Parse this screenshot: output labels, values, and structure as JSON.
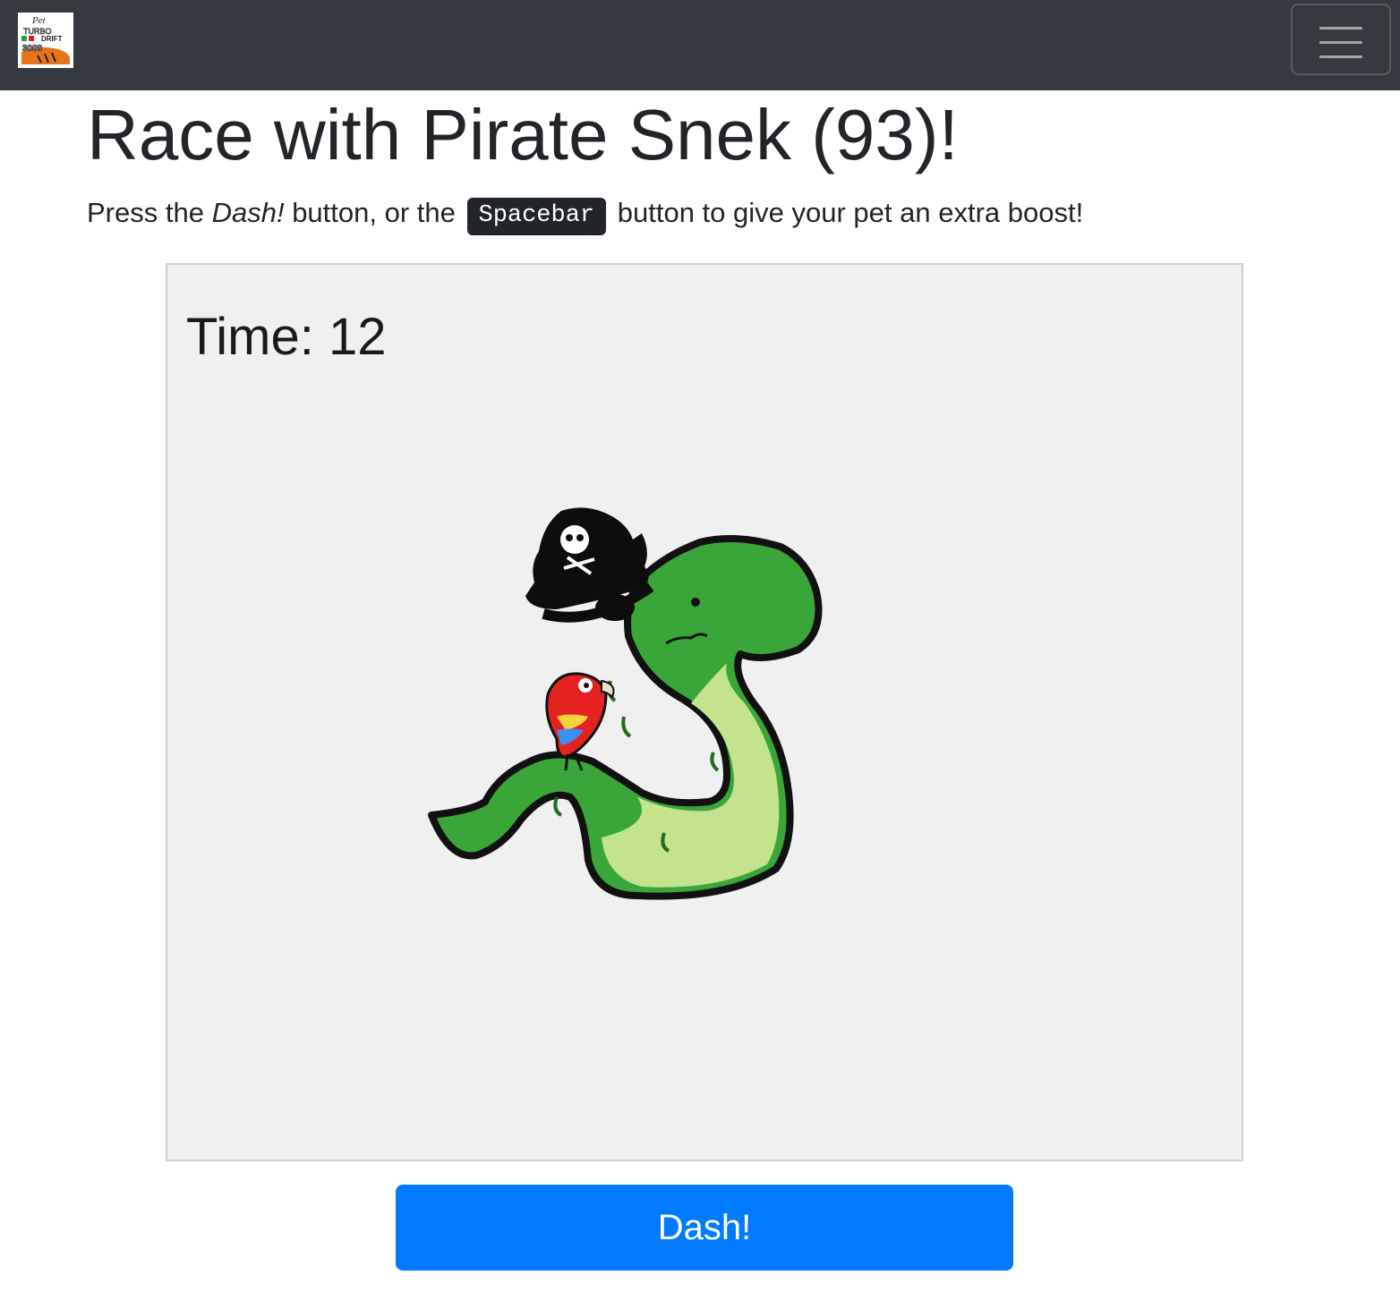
{
  "navbar": {
    "brand": {
      "logo_icon": "pet-turbo-drift-logo-icon",
      "logo_text": [
        "Pet",
        "TURBO",
        "DRIFT",
        "3000"
      ]
    },
    "toggler": {
      "icon": "hamburger-menu-icon"
    }
  },
  "page": {
    "title": "Race with Pirate Snek (93)!",
    "instructions": {
      "prefix": "Press the",
      "dash_word": "Dash!",
      "middle": "button, or the",
      "key": "Spacebar",
      "suffix": "button to give your pet an extra boost!"
    }
  },
  "game": {
    "timer": {
      "label": "Time:",
      "value": "12"
    },
    "pet": {
      "name": "Pirate Snek",
      "sprite_icon": "pirate-snake-with-parrot-icon"
    }
  },
  "dash_button": {
    "label": "Dash!"
  },
  "colors": {
    "navbar_bg": "#343a40",
    "primary_button": "#007bff",
    "canvas_bg": "#f0f0f0",
    "snake_green": "#3aa63a"
  }
}
